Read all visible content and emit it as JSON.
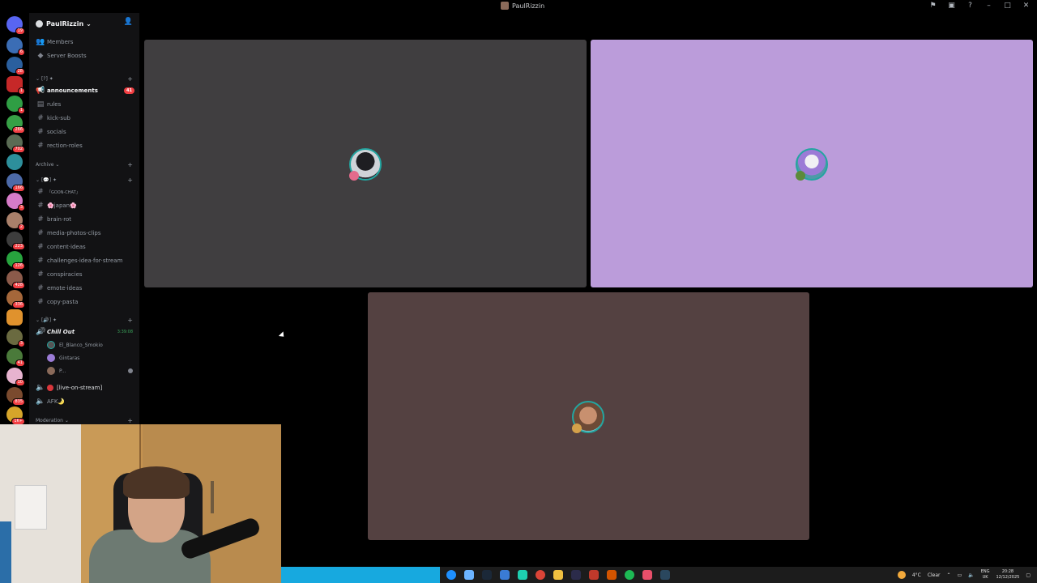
{
  "window": {
    "title": "PaulRizzin"
  },
  "server": {
    "name": "PaulRizzin",
    "top_items": [
      "Members",
      "Server Boosts"
    ]
  },
  "rail_badges": [
    "19",
    "6",
    "28",
    "1",
    "1",
    "266",
    "702",
    "166",
    "3",
    "2",
    "223",
    "126",
    "1",
    "428",
    "336",
    "3",
    "41",
    "10",
    "835",
    "1K+"
  ],
  "categories": {
    "cat1": "[?] ✦",
    "archive": "Archive",
    "cat2": "[💬] ✦",
    "cat3": "[🔊] ✦",
    "moderation": "Moderation"
  },
  "channels_top": [
    {
      "name": "announcements",
      "unread": "41",
      "active": true,
      "icon": "announce-icon"
    },
    {
      "name": "rules",
      "icon": "rules-icon"
    },
    {
      "name": "kick-sub",
      "icon": "hash-icon"
    },
    {
      "name": "socials",
      "icon": "hash-icon"
    },
    {
      "name": "rection-roles",
      "icon": "hash-icon"
    }
  ],
  "channels_text": [
    "「GOON-CHAT」",
    "🌸japan🌸",
    "brain·rot",
    "media-photos-clips",
    "content·ideas",
    "challenges·idea·for·stream",
    "conspiracies",
    "emote·ideas",
    "copy·pasta"
  ],
  "voice": {
    "channel": "Chill Out",
    "duration": "3:39:08",
    "members": [
      "El_Blanco_Smokio",
      "Gintaras",
      "P..."
    ],
    "other_channels": [
      "[live-on-stream]",
      "AFK🌛"
    ]
  },
  "taskbar": {
    "weather_temp": "4°C",
    "weather_text": "Clear",
    "lang_top": "ENG",
    "lang_bottom": "UK",
    "time": "20:28",
    "date": "12/12/2025"
  },
  "colors": {
    "tile1": "#403e40",
    "tile2": "#bb9cda",
    "tile3": "#544141",
    "speaking_ring": "#23a5a0",
    "unread_badge": "#f23f43"
  }
}
